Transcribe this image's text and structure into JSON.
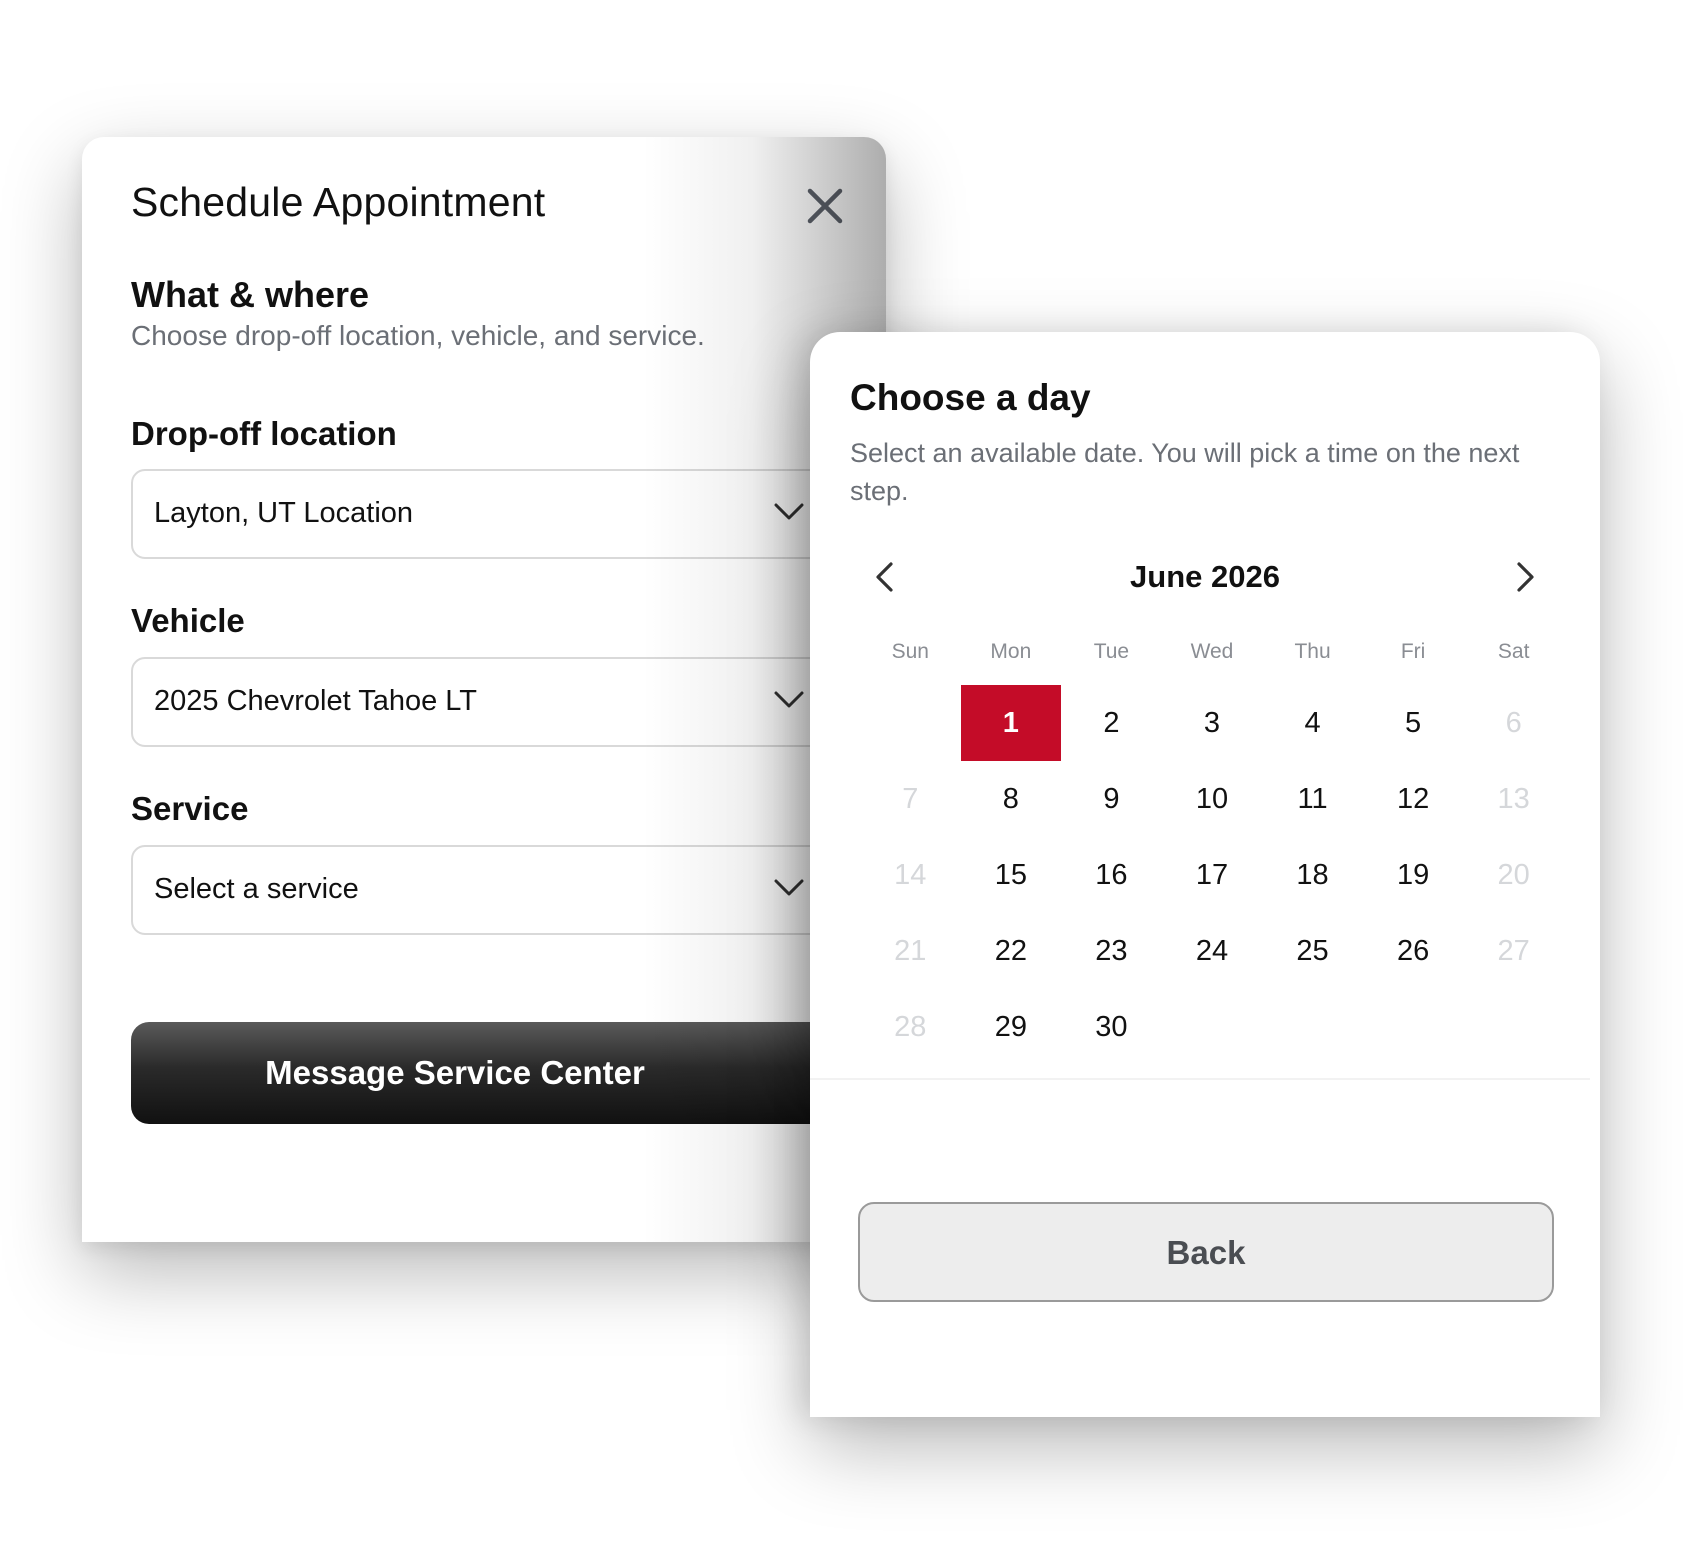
{
  "appointment_modal": {
    "title": "Schedule Appointment",
    "close_icon": "close-icon",
    "section_heading": "What & where",
    "section_subtitle": "Choose drop-off location, vehicle, and service.",
    "fields": [
      {
        "label": "Drop-off location",
        "value": "Layton, UT Location",
        "icon": "chevron-down-icon"
      },
      {
        "label": "Vehicle",
        "value": "2025 Chevrolet Tahoe LT",
        "icon": "chevron-down-icon"
      },
      {
        "label": "Service",
        "value": "Select a service",
        "icon": "chevron-down-icon"
      }
    ],
    "primary_button": "Message Service Center"
  },
  "day_picker": {
    "title": "Choose a day",
    "subtitle": "Select an available date. You will pick a time on the next step.",
    "prev_icon": "chevron-left-icon",
    "next_icon": "chevron-right-icon",
    "month_label": "June 2026",
    "weekdays": [
      "Sun",
      "Mon",
      "Tue",
      "Wed",
      "Thu",
      "Fri",
      "Sat"
    ],
    "first_weekday_index": 1,
    "days": [
      {
        "day": "1",
        "available": true,
        "selected": true
      },
      {
        "day": "2",
        "available": true
      },
      {
        "day": "3",
        "available": true
      },
      {
        "day": "4",
        "available": true
      },
      {
        "day": "5",
        "available": true
      },
      {
        "day": "6",
        "available": false
      },
      {
        "day": "7",
        "available": false
      },
      {
        "day": "8",
        "available": true
      },
      {
        "day": "9",
        "available": true
      },
      {
        "day": "10",
        "available": true
      },
      {
        "day": "11",
        "available": true
      },
      {
        "day": "12",
        "available": true
      },
      {
        "day": "13",
        "available": false
      },
      {
        "day": "14",
        "available": false
      },
      {
        "day": "15",
        "available": true
      },
      {
        "day": "16",
        "available": true
      },
      {
        "day": "17",
        "available": true
      },
      {
        "day": "18",
        "available": true
      },
      {
        "day": "19",
        "available": true
      },
      {
        "day": "20",
        "available": false
      },
      {
        "day": "21",
        "available": false
      },
      {
        "day": "22",
        "available": true
      },
      {
        "day": "23",
        "available": true
      },
      {
        "day": "24",
        "available": true
      },
      {
        "day": "25",
        "available": true
      },
      {
        "day": "26",
        "available": true
      },
      {
        "day": "27",
        "available": false
      },
      {
        "day": "28",
        "available": false
      },
      {
        "day": "29",
        "available": true
      },
      {
        "day": "30",
        "available": true
      }
    ],
    "back_button": "Back"
  },
  "colors": {
    "selected_day": "#c40c28",
    "muted_text": "#6b6f76",
    "unavailable_day": "#d5d7da",
    "primary_button": "#111111"
  }
}
